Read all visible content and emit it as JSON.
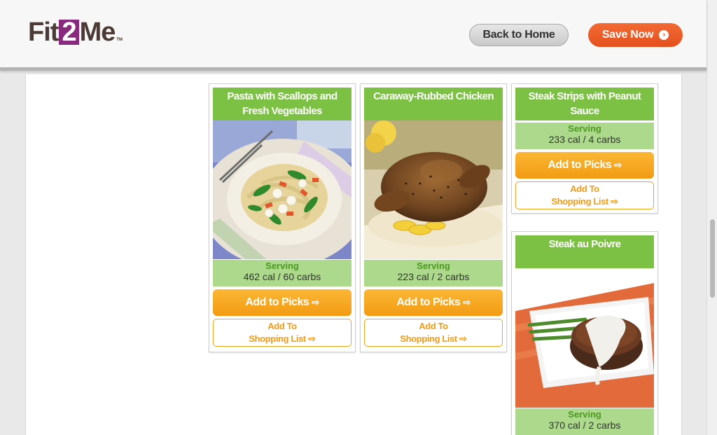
{
  "header": {
    "logo_pre": "Fit",
    "logo_mid": "2",
    "logo_post": "Me",
    "logo_tm": "TM",
    "back_label": "Back to Home",
    "save_label": "Save Now",
    "save_icon": "›"
  },
  "colors": {
    "title_green": "#7cc143",
    "serving_green": "#acd98b",
    "orange": "#f39a12",
    "save_orange": "#e4501d",
    "logo_purple": "#8a2a7f"
  },
  "common": {
    "serving_label": "Serving",
    "picks_label": "Add to Picks",
    "picks_icon": "⇨",
    "shop_line1": "Add To",
    "shop_line2": "Shopping List",
    "shop_icon": "⇨"
  },
  "recipes": [
    {
      "title": "Pasta with Scallops and Fresh Vegetables",
      "nutrition": "462 cal / 60 carbs",
      "image": "pasta-scallops-photo"
    },
    {
      "title": "Caraway-Rubbed Chicken",
      "nutrition": "223 cal / 2 carbs",
      "image": "roast-chicken-photo"
    },
    {
      "title": "Steak Strips with Peanut Sauce",
      "nutrition": "233 cal / 4 carbs",
      "image": ""
    },
    {
      "title": "Steak au Poivre",
      "nutrition": "370 cal / 2 carbs",
      "image": "steak-au-poivre-photo"
    }
  ]
}
